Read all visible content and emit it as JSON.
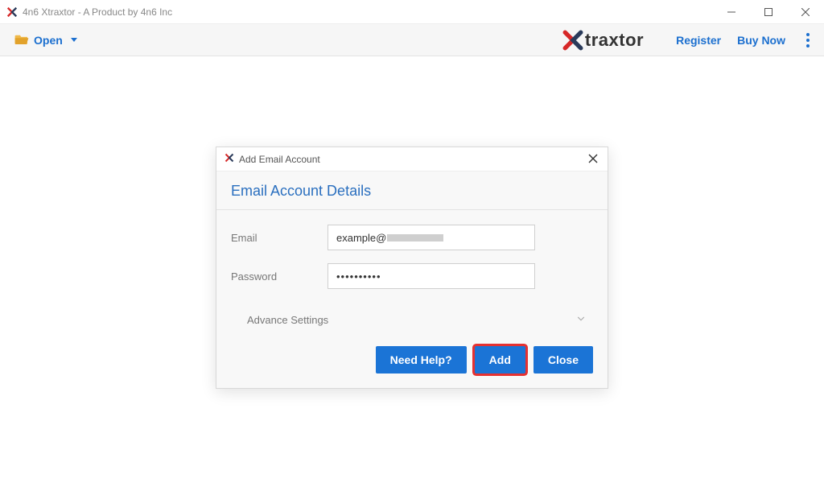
{
  "window": {
    "title": "4n6 Xtraxtor - A Product by 4n6 Inc"
  },
  "toolbar": {
    "open_label": "Open",
    "register_label": "Register",
    "buy_now_label": "Buy Now",
    "brand_text": "traxtor"
  },
  "dialog": {
    "title": "Add Email Account",
    "heading": "Email Account Details",
    "email_label": "Email",
    "email_value_prefix": "example@",
    "password_label": "Password",
    "password_value": "••••••••••",
    "advance_label": "Advance Settings",
    "buttons": {
      "help": "Need Help?",
      "add": "Add",
      "close": "Close"
    }
  }
}
